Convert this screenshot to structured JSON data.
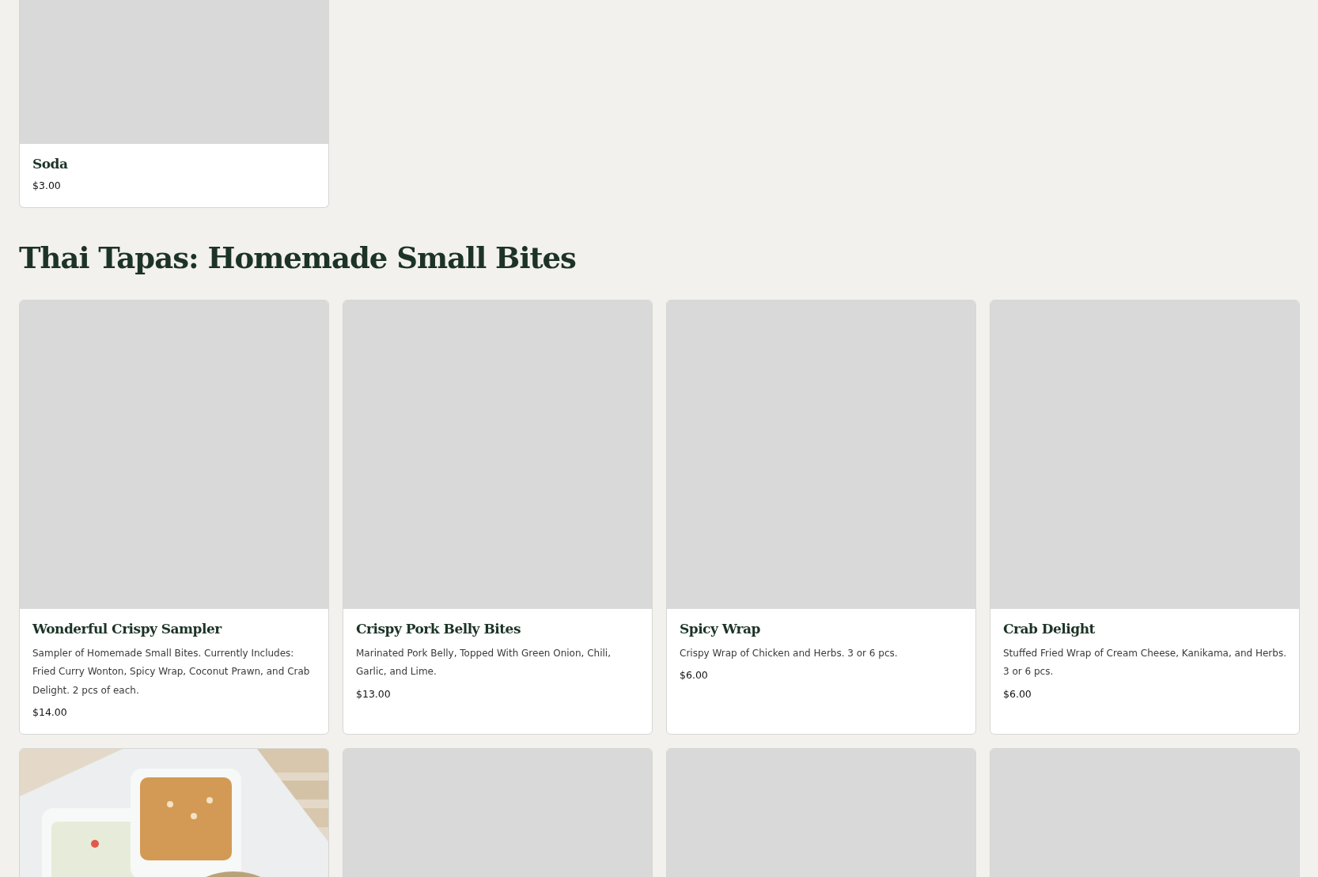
{
  "sections": [
    {
      "items": [
        {
          "kind": "placeholder",
          "name": "Soda",
          "price": "$3.00"
        }
      ]
    },
    {
      "title": "Thai Tapas: Homemade Small Bites",
      "items": [
        {
          "kind": "placeholder",
          "name": "Wonderful Crispy Sampler",
          "description": "Sampler of Homemade Small Bites. Currently Includes: Fried Curry Wonton, Spicy Wrap, Coconut Prawn, and Crab Delight. 2 pcs of each.",
          "price": "$14.00"
        },
        {
          "kind": "placeholder",
          "name": "Crispy Pork Belly Bites",
          "description": "Marinated Pork Belly, Topped With Green Onion, Chili, Garlic, and Lime.",
          "price": "$13.00"
        },
        {
          "kind": "placeholder",
          "name": "Spicy Wrap",
          "description": "Crispy Wrap of Chicken and Herbs. 3 or 6 pcs.",
          "price": "$6.00"
        },
        {
          "kind": "placeholder",
          "name": "Crab Delight",
          "description": "Stuffed Fried Wrap of Cream Cheese, Kanikama, and Herbs. 3 or 6 pcs.",
          "price": "$6.00"
        },
        {
          "kind": "picture"
        },
        {
          "kind": "placeholder"
        },
        {
          "kind": "placeholder"
        },
        {
          "kind": "placeholder"
        }
      ]
    }
  ]
}
